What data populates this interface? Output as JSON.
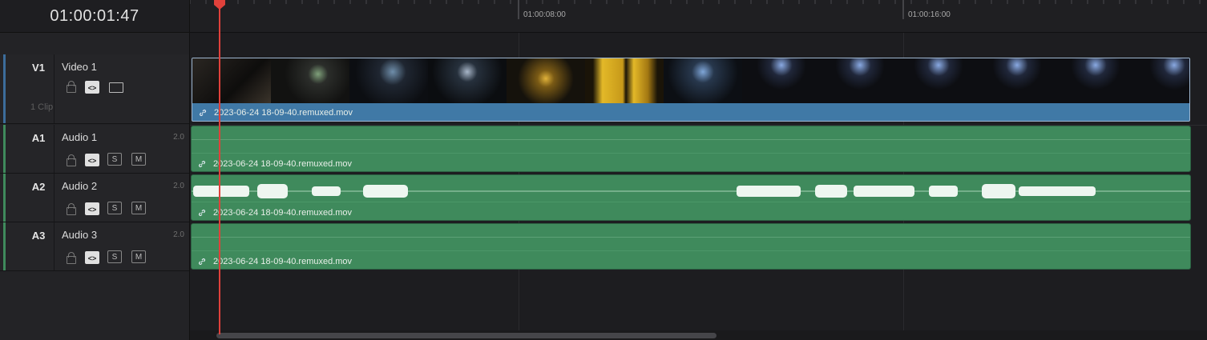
{
  "timecode": "01:00:01:47",
  "ruler": {
    "ticks": [
      "01:00:08:00",
      "01:00:16:00"
    ]
  },
  "tracks": {
    "v1": {
      "id": "V1",
      "name": "Video 1",
      "clip_count": "1 Clip",
      "color": "#4079a6"
    },
    "a1": {
      "id": "A1",
      "name": "Audio 1",
      "channels": "2.0",
      "solo": "S",
      "mute": "M"
    },
    "a2": {
      "id": "A2",
      "name": "Audio 2",
      "channels": "2.0",
      "solo": "S",
      "mute": "M"
    },
    "a3": {
      "id": "A3",
      "name": "Audio 3",
      "channels": "2.0",
      "solo": "S",
      "mute": "M"
    }
  },
  "clips": {
    "video": "2023-06-24 18-09-40.remuxed.mov",
    "audio1": "2023-06-24 18-09-40.remuxed.mov",
    "audio2": "2023-06-24 18-09-40.remuxed.mov",
    "audio3": "2023-06-24 18-09-40.remuxed.mov"
  },
  "colors": {
    "video_clip": "#4079a6",
    "audio_clip": "#3f8a5c",
    "playhead": "#e0413b",
    "video_track_bar": "#3c6d9b",
    "audio_track_bar": "#3f8a5c"
  }
}
